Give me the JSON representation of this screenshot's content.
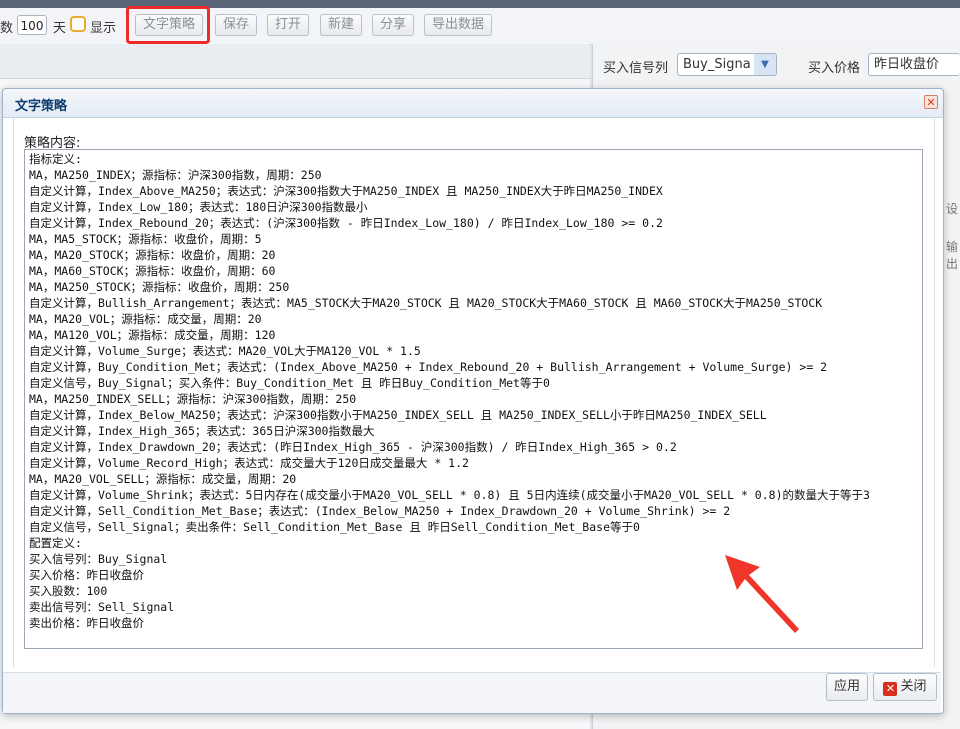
{
  "toolbar": {
    "prefix_label": "数",
    "days_value": "100",
    "days_unit": "天",
    "show_label": "显示",
    "buttons": {
      "text_strategy": "文字策略",
      "save": "保存",
      "open": "打开",
      "new": "新建",
      "share": "分享",
      "export": "导出数据"
    }
  },
  "right_panel": {
    "buy_signal_label": "买入信号列",
    "buy_signal_value": "Buy_Signa",
    "buy_price_label": "买入价格",
    "buy_price_value": "昨日收盘价",
    "edge_text_1": "设",
    "edge_text_2": "输出"
  },
  "dialog": {
    "title": "文字策略",
    "content_label": "策略内容:",
    "lines": [
      "指标定义:",
      "MA，MA250_INDEX；源指标：沪深300指数，周期：250",
      "自定义计算，Index_Above_MA250；表达式：沪深300指数大于MA250_INDEX 且 MA250_INDEX大于昨日MA250_INDEX",
      "自定义计算，Index_Low_180；表达式：180日沪深300指数最小",
      "自定义计算，Index_Rebound_20；表达式：(沪深300指数 - 昨日Index_Low_180) / 昨日Index_Low_180 >= 0.2",
      "MA，MA5_STOCK；源指标：收盘价，周期：5",
      "MA，MA20_STOCK；源指标：收盘价，周期：20",
      "MA，MA60_STOCK；源指标：收盘价，周期：60",
      "MA，MA250_STOCK；源指标：收盘价，周期：250",
      "自定义计算，Bullish_Arrangement；表达式：MA5_STOCK大于MA20_STOCK 且 MA20_STOCK大于MA60_STOCK 且 MA60_STOCK大于MA250_STOCK",
      "MA，MA20_VOL；源指标：成交量，周期：20",
      "MA，MA120_VOL；源指标：成交量，周期：120",
      "自定义计算，Volume_Surge；表达式：MA20_VOL大于MA120_VOL * 1.5",
      "自定义计算，Buy_Condition_Met；表达式：(Index_Above_MA250 + Index_Rebound_20 + Bullish_Arrangement + Volume_Surge) >= 2",
      "自定义信号，Buy_Signal；买入条件：Buy_Condition_Met 且 昨日Buy_Condition_Met等于0",
      "MA，MA250_INDEX_SELL；源指标：沪深300指数，周期：250",
      "自定义计算，Index_Below_MA250；表达式：沪深300指数小于MA250_INDEX_SELL 且 MA250_INDEX_SELL小于昨日MA250_INDEX_SELL",
      "自定义计算，Index_High_365；表达式：365日沪深300指数最大",
      "自定义计算，Index_Drawdown_20；表达式：(昨日Index_High_365 - 沪深300指数) / 昨日Index_High_365 > 0.2",
      "自定义计算，Volume_Record_High；表达式：成交量大于120日成交量最大 * 1.2",
      "MA，MA20_VOL_SELL；源指标：成交量，周期：20",
      "自定义计算，Volume_Shrink；表达式：5日内存在(成交量小于MA20_VOL_SELL * 0.8) 且 5日内连续(成交量小于MA20_VOL_SELL * 0.8)的数量大于等于3",
      "自定义计算，Sell_Condition_Met_Base；表达式：(Index_Below_MA250 + Index_Drawdown_20 + Volume_Shrink) >= 2",
      "自定义信号，Sell_Signal；卖出条件：Sell_Condition_Met_Base 且 昨日Sell_Condition_Met_Base等于0",
      "配置定义:",
      "买入信号列：Buy_Signal",
      "买入价格：昨日收盘价",
      "买入股数：100",
      "卖出信号列：Sell_Signal",
      "卖出价格：昨日收盘价"
    ],
    "apply_label": "应用",
    "close_label": "关闭"
  },
  "icons": {
    "close": "close-icon",
    "dropdown": "chevron-down-icon",
    "annotation_arrow": "arrow-annotation"
  },
  "colors": {
    "highlight": "#ee2b2b",
    "arrow": "#f0362b",
    "title_text": "#0d3c6e",
    "checkbox_border": "#f0a830"
  }
}
